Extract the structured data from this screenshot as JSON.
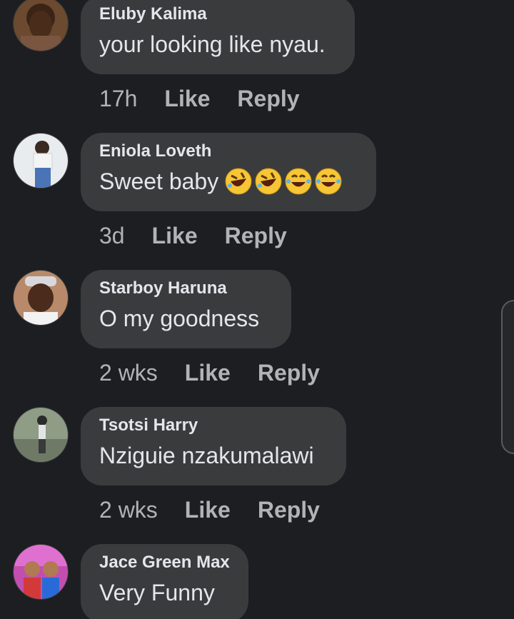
{
  "comments": [
    {
      "author": "Eluby Kalima",
      "text": "your looking like nyau.",
      "time": "17h",
      "like": "Like",
      "reply": "Reply"
    },
    {
      "author": "Eniola Loveth",
      "text": "Sweet baby",
      "emojis": [
        "rolling-on-floor-laughing",
        "rolling-on-floor-laughing",
        "tears-of-joy",
        "tears-of-joy"
      ],
      "time": "3d",
      "like": "Like",
      "reply": "Reply"
    },
    {
      "author": "Starboy Haruna",
      "text": "O my goodness",
      "time": "2 wks",
      "like": "Like",
      "reply": "Reply"
    },
    {
      "author": "Tsotsi Harry",
      "text": "Nziguie nzakumalawi",
      "time": "2 wks",
      "like": "Like",
      "reply": "Reply"
    },
    {
      "author": "Jace Green Max",
      "text": "Very Funny"
    }
  ],
  "colors": {
    "background": "#1c1e21",
    "bubble": "#3a3b3c",
    "text": "#e4e6eb",
    "meta": "#b0b3b8"
  }
}
